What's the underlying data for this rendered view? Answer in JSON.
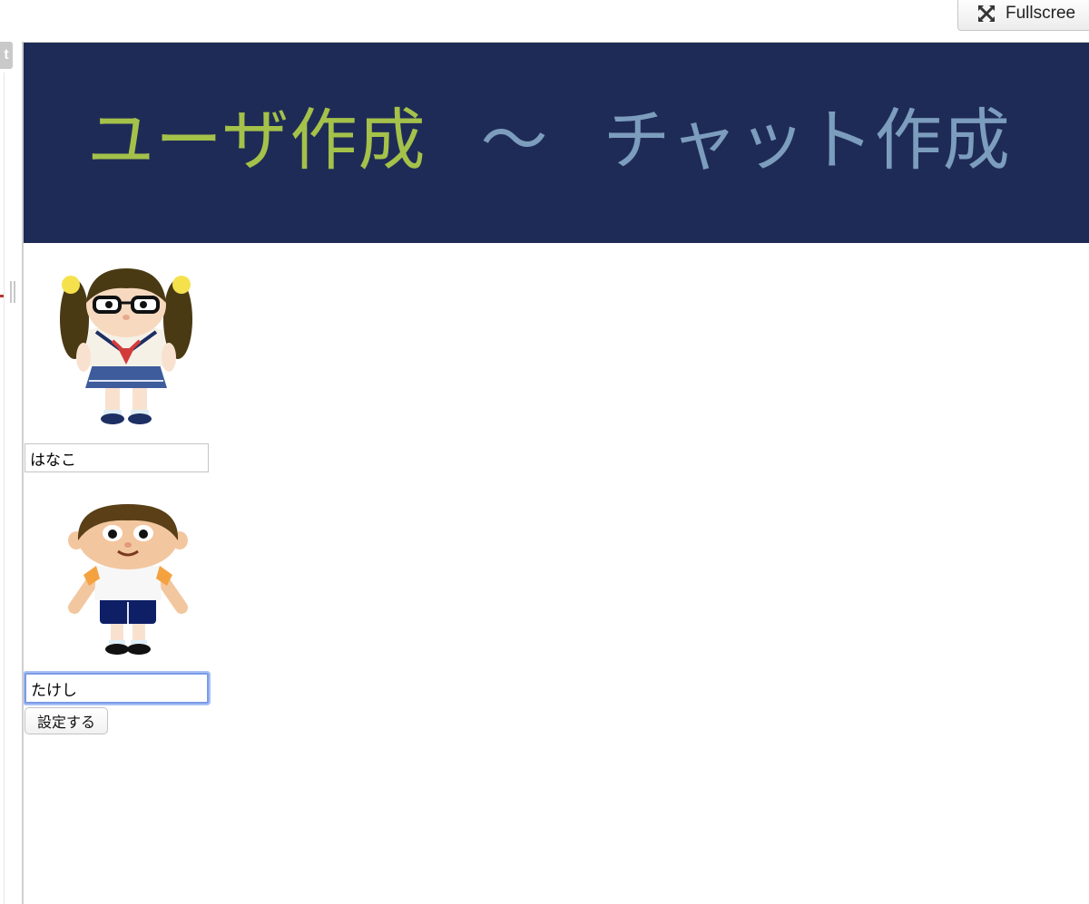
{
  "toolbar": {
    "fullscreen_label": "Fullscree",
    "left_tab_glyph": "t"
  },
  "banner": {
    "step1": "ユーザ作成",
    "separator": "〜",
    "step2": "チャット作成",
    "step3": "〈"
  },
  "colors": {
    "banner_background": "#1f2b57",
    "active_step": "#a4c14a",
    "inactive_step": "#7c9dbd",
    "focus_ring": "#7a9be8"
  },
  "users": [
    {
      "avatar": "girl-avatar",
      "name_value": "はなこ"
    },
    {
      "avatar": "boy-avatar",
      "name_value": "たけし"
    }
  ],
  "form": {
    "submit_label": "設定する"
  }
}
